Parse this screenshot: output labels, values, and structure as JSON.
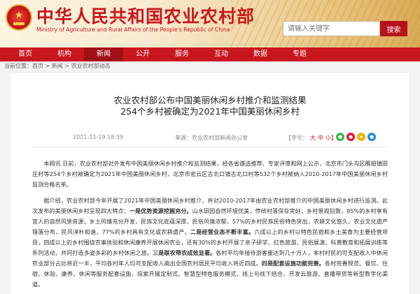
{
  "header": {
    "site_title": "中华人民共和国农业农村部",
    "site_subtitle": "Ministry of Agriculture and Rural Affairs of the People's Republic of China",
    "search_placeholder": "请输入关键字",
    "search_button": "搜索"
  },
  "nav": {
    "items": [
      {
        "label": "首页"
      },
      {
        "label": "机构"
      },
      {
        "label": "新闻"
      },
      {
        "label": "公开"
      },
      {
        "label": "服务"
      },
      {
        "label": "互动"
      },
      {
        "label": "数据"
      },
      {
        "label": "专题"
      }
    ],
    "active": "新闻"
  },
  "breadcrumb": "当前位置：首页 > 新闻 > 农业农村部动态",
  "article": {
    "title_line1": "农业农村部公布中国美丽休闲乡村推介和监测结果",
    "title_line2": "254个乡村被确定为2021年中国美丽休闲乡村",
    "date": "2021-11-19 18:39",
    "source": "来源：农业农村部新闻办公室",
    "font_size_label": "【字号：",
    "font_lg": "大",
    "font_md": "中",
    "font_sm": "小】",
    "para1": "本网讯 日前，农业农村部对外发布中国美丽休闲乡村推介和监测结果，经各省遴选推荐、专家评审和网上公示，北京市门头沟区雁翅镇田庄村等254个乡村被确定为2021年中国美丽休闲乡村，北京市密云区古北口镇古北口村等532个乡村被纳入2010-2017年中国美丽休闲乡村监测合格名单。",
    "para2_a": "据介绍，农业农村部今年开展了2021年中国美丽休闲乡村推介，并对2010-2017年由农业农村部推介的中国美丽休闲乡村进行监测。此次发布的美丽休闲乡村呈现四大特点：",
    "para2_b1": "一是优势资源挖掘充分。",
    "para2_c": "山水田园自然环境优美，传统村落保存完好，乡村景观别致，95%的乡村享有宜人的自然风景资源，乡土风情充分开发，民族文化底蕴深厚，民俗风情浓郁，57%的乡村民族民俗特色突出，农耕文化悠久，农业文化遗产错落分布，民风淳朴和谐，77%的乡村具有文化或农耕遗产。",
    "para2_b2": "二是经营业态不断丰富。",
    "para2_d": "六成以上的乡村以特色民宿和乡土美食为主要经营项目，四成以上的乡村围绕农事体验和休闲康养开展休闲农业，还有30%的乡村开展了亲子研学、红色旅游、民俗展演、科普教育和拓展训练等系列活动，共同打造多姿多彩的乡村休闲之旅。",
    "para2_b3": "三是联农带农成效显著。",
    "para2_e": "各村平均年接待游客量达到几十万人，本村村民的可支配收入中休闲农业部分占比将近一半，平均各村年人均可支配收入高出全国农村居民平均收入将近四成。",
    "para2_b4": "四是配套设施功能完善。",
    "para2_f": "各村完善规范、餐饮、住宿、休验、康养、休闲等服务配套设施，探索开展定制式、智慧型特色服务模式，线上与线下结合，开发云旅游、直播带货等新型数字化渠道。"
  },
  "colors": {
    "brand_red": "#c8161d",
    "nav_active": "#a10f16"
  },
  "icons": [
    "national-emblem-icon",
    "wechat-icon",
    "weibo-icon",
    "qzone-icon",
    "qq-icon"
  ]
}
